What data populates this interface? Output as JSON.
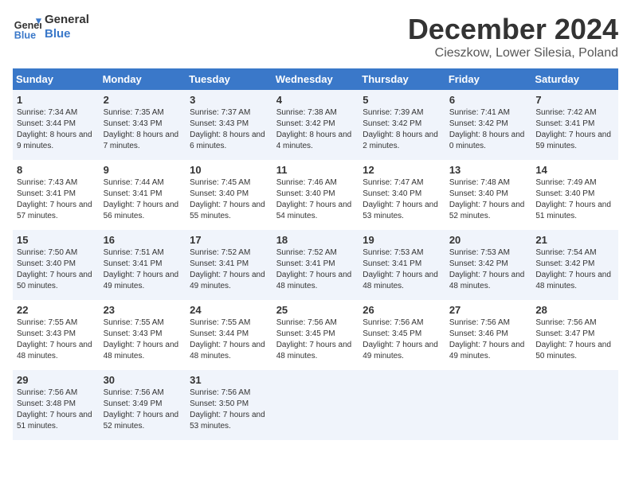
{
  "header": {
    "logo_line1": "General",
    "logo_line2": "Blue",
    "month": "December 2024",
    "location": "Cieszkow, Lower Silesia, Poland"
  },
  "weekdays": [
    "Sunday",
    "Monday",
    "Tuesday",
    "Wednesday",
    "Thursday",
    "Friday",
    "Saturday"
  ],
  "weeks": [
    [
      {
        "day": "1",
        "sunrise": "Sunrise: 7:34 AM",
        "sunset": "Sunset: 3:44 PM",
        "daylight": "Daylight: 8 hours and 9 minutes."
      },
      {
        "day": "2",
        "sunrise": "Sunrise: 7:35 AM",
        "sunset": "Sunset: 3:43 PM",
        "daylight": "Daylight: 8 hours and 7 minutes."
      },
      {
        "day": "3",
        "sunrise": "Sunrise: 7:37 AM",
        "sunset": "Sunset: 3:43 PM",
        "daylight": "Daylight: 8 hours and 6 minutes."
      },
      {
        "day": "4",
        "sunrise": "Sunrise: 7:38 AM",
        "sunset": "Sunset: 3:42 PM",
        "daylight": "Daylight: 8 hours and 4 minutes."
      },
      {
        "day": "5",
        "sunrise": "Sunrise: 7:39 AM",
        "sunset": "Sunset: 3:42 PM",
        "daylight": "Daylight: 8 hours and 2 minutes."
      },
      {
        "day": "6",
        "sunrise": "Sunrise: 7:41 AM",
        "sunset": "Sunset: 3:42 PM",
        "daylight": "Daylight: 8 hours and 0 minutes."
      },
      {
        "day": "7",
        "sunrise": "Sunrise: 7:42 AM",
        "sunset": "Sunset: 3:41 PM",
        "daylight": "Daylight: 7 hours and 59 minutes."
      }
    ],
    [
      {
        "day": "8",
        "sunrise": "Sunrise: 7:43 AM",
        "sunset": "Sunset: 3:41 PM",
        "daylight": "Daylight: 7 hours and 57 minutes."
      },
      {
        "day": "9",
        "sunrise": "Sunrise: 7:44 AM",
        "sunset": "Sunset: 3:41 PM",
        "daylight": "Daylight: 7 hours and 56 minutes."
      },
      {
        "day": "10",
        "sunrise": "Sunrise: 7:45 AM",
        "sunset": "Sunset: 3:40 PM",
        "daylight": "Daylight: 7 hours and 55 minutes."
      },
      {
        "day": "11",
        "sunrise": "Sunrise: 7:46 AM",
        "sunset": "Sunset: 3:40 PM",
        "daylight": "Daylight: 7 hours and 54 minutes."
      },
      {
        "day": "12",
        "sunrise": "Sunrise: 7:47 AM",
        "sunset": "Sunset: 3:40 PM",
        "daylight": "Daylight: 7 hours and 53 minutes."
      },
      {
        "day": "13",
        "sunrise": "Sunrise: 7:48 AM",
        "sunset": "Sunset: 3:40 PM",
        "daylight": "Daylight: 7 hours and 52 minutes."
      },
      {
        "day": "14",
        "sunrise": "Sunrise: 7:49 AM",
        "sunset": "Sunset: 3:40 PM",
        "daylight": "Daylight: 7 hours and 51 minutes."
      }
    ],
    [
      {
        "day": "15",
        "sunrise": "Sunrise: 7:50 AM",
        "sunset": "Sunset: 3:40 PM",
        "daylight": "Daylight: 7 hours and 50 minutes."
      },
      {
        "day": "16",
        "sunrise": "Sunrise: 7:51 AM",
        "sunset": "Sunset: 3:41 PM",
        "daylight": "Daylight: 7 hours and 49 minutes."
      },
      {
        "day": "17",
        "sunrise": "Sunrise: 7:52 AM",
        "sunset": "Sunset: 3:41 PM",
        "daylight": "Daylight: 7 hours and 49 minutes."
      },
      {
        "day": "18",
        "sunrise": "Sunrise: 7:52 AM",
        "sunset": "Sunset: 3:41 PM",
        "daylight": "Daylight: 7 hours and 48 minutes."
      },
      {
        "day": "19",
        "sunrise": "Sunrise: 7:53 AM",
        "sunset": "Sunset: 3:41 PM",
        "daylight": "Daylight: 7 hours and 48 minutes."
      },
      {
        "day": "20",
        "sunrise": "Sunrise: 7:53 AM",
        "sunset": "Sunset: 3:42 PM",
        "daylight": "Daylight: 7 hours and 48 minutes."
      },
      {
        "day": "21",
        "sunrise": "Sunrise: 7:54 AM",
        "sunset": "Sunset: 3:42 PM",
        "daylight": "Daylight: 7 hours and 48 minutes."
      }
    ],
    [
      {
        "day": "22",
        "sunrise": "Sunrise: 7:55 AM",
        "sunset": "Sunset: 3:43 PM",
        "daylight": "Daylight: 7 hours and 48 minutes."
      },
      {
        "day": "23",
        "sunrise": "Sunrise: 7:55 AM",
        "sunset": "Sunset: 3:43 PM",
        "daylight": "Daylight: 7 hours and 48 minutes."
      },
      {
        "day": "24",
        "sunrise": "Sunrise: 7:55 AM",
        "sunset": "Sunset: 3:44 PM",
        "daylight": "Daylight: 7 hours and 48 minutes."
      },
      {
        "day": "25",
        "sunrise": "Sunrise: 7:56 AM",
        "sunset": "Sunset: 3:45 PM",
        "daylight": "Daylight: 7 hours and 48 minutes."
      },
      {
        "day": "26",
        "sunrise": "Sunrise: 7:56 AM",
        "sunset": "Sunset: 3:45 PM",
        "daylight": "Daylight: 7 hours and 49 minutes."
      },
      {
        "day": "27",
        "sunrise": "Sunrise: 7:56 AM",
        "sunset": "Sunset: 3:46 PM",
        "daylight": "Daylight: 7 hours and 49 minutes."
      },
      {
        "day": "28",
        "sunrise": "Sunrise: 7:56 AM",
        "sunset": "Sunset: 3:47 PM",
        "daylight": "Daylight: 7 hours and 50 minutes."
      }
    ],
    [
      {
        "day": "29",
        "sunrise": "Sunrise: 7:56 AM",
        "sunset": "Sunset: 3:48 PM",
        "daylight": "Daylight: 7 hours and 51 minutes."
      },
      {
        "day": "30",
        "sunrise": "Sunrise: 7:56 AM",
        "sunset": "Sunset: 3:49 PM",
        "daylight": "Daylight: 7 hours and 52 minutes."
      },
      {
        "day": "31",
        "sunrise": "Sunrise: 7:56 AM",
        "sunset": "Sunset: 3:50 PM",
        "daylight": "Daylight: 7 hours and 53 minutes."
      },
      null,
      null,
      null,
      null
    ]
  ]
}
